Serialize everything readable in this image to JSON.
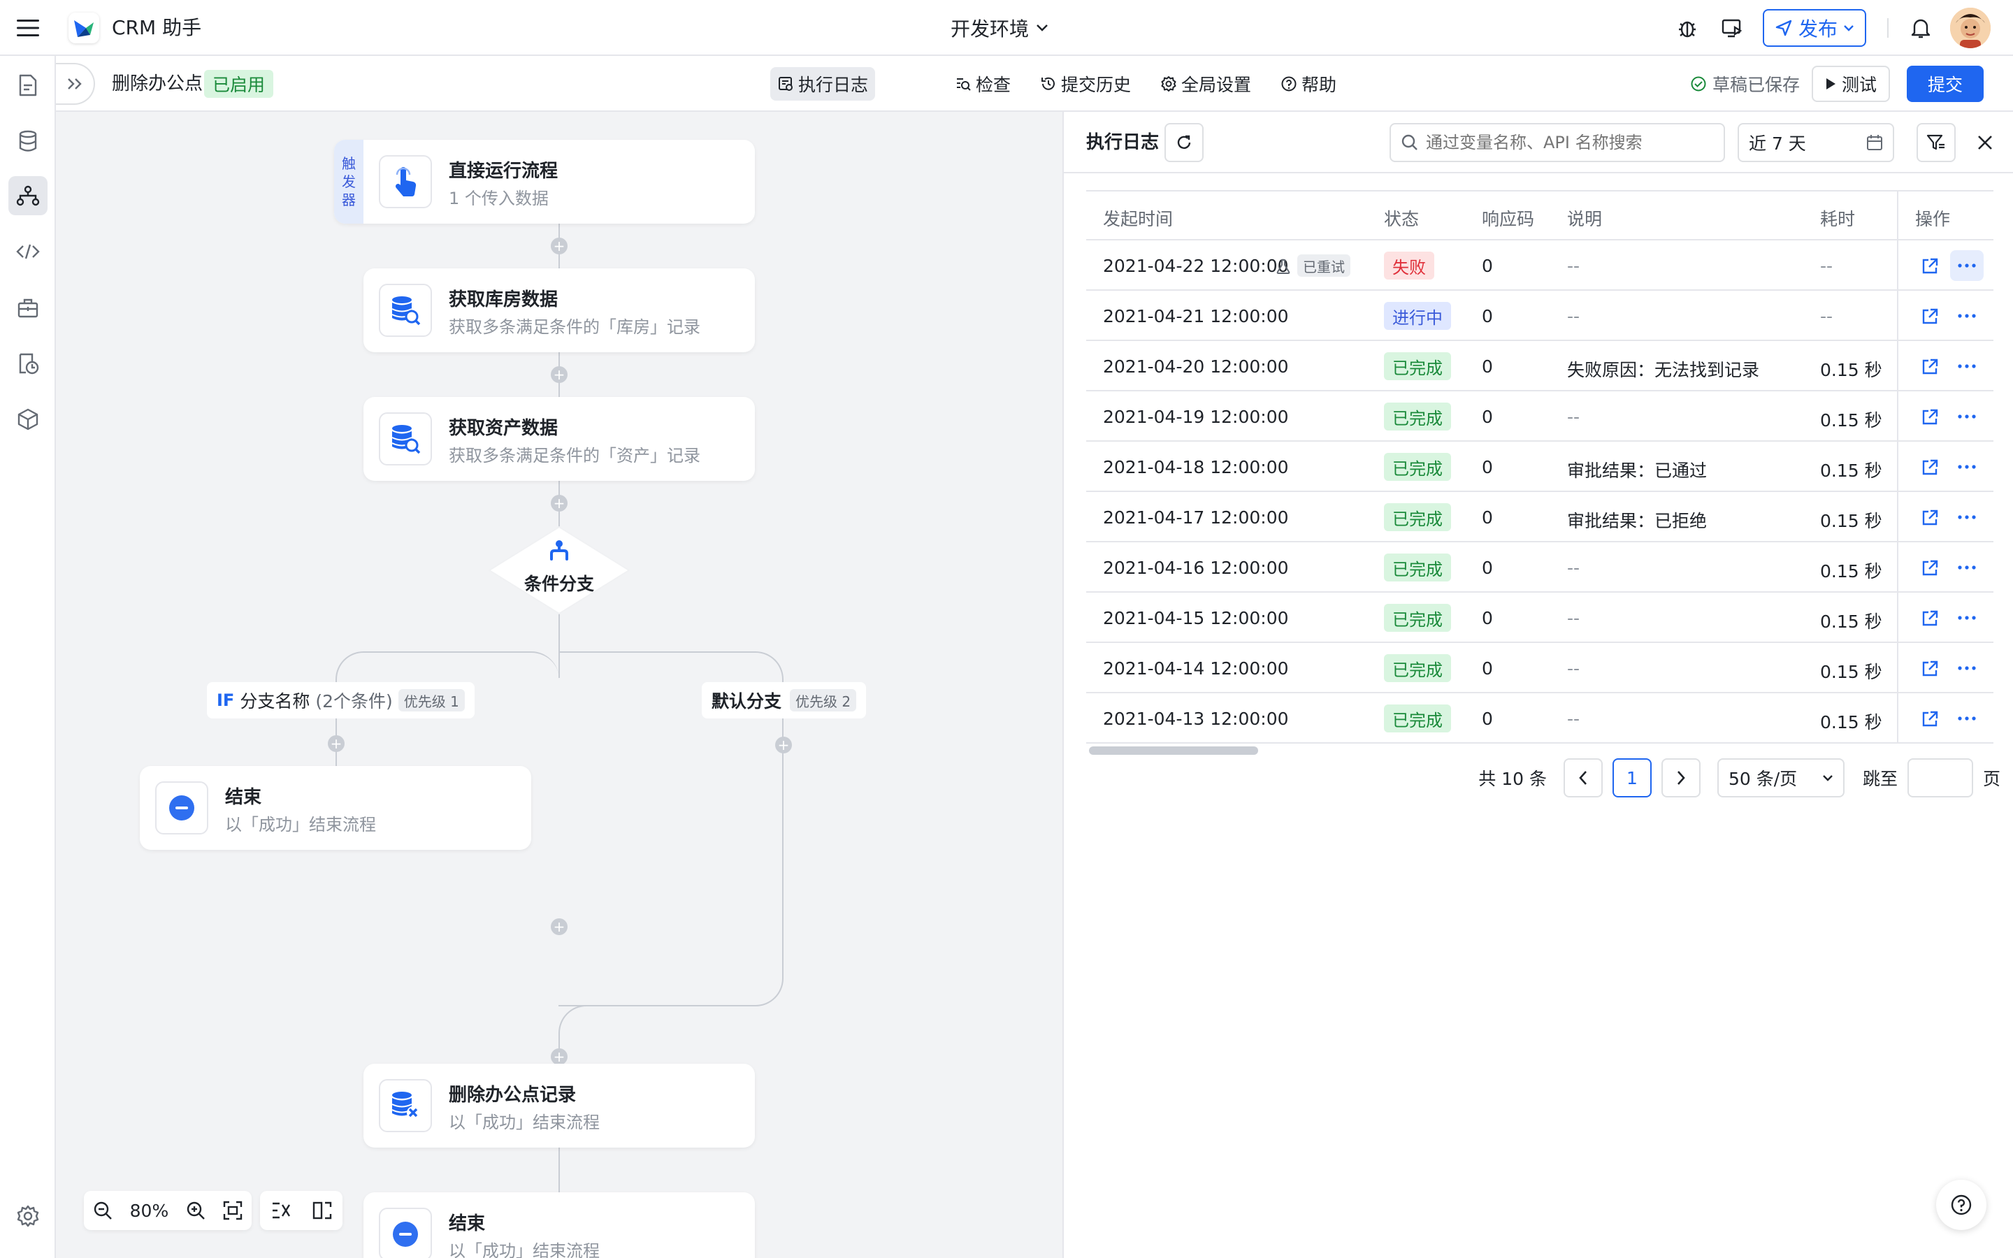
{
  "app": {
    "title": "CRM 助手",
    "environment": "开发环境"
  },
  "topbar": {
    "publish_label": "发布"
  },
  "subbar": {
    "flow_name": "删除办公点",
    "flow_status": "已启用",
    "tabs": [
      "执行日志",
      "检查",
      "提交历史",
      "全局设置",
      "帮助"
    ],
    "draft_status": "草稿已保存",
    "test_label": "测试",
    "submit_label": "提交"
  },
  "flow": {
    "trigger_badge": "触发器",
    "nodes": {
      "trigger": {
        "title": "直接运行流程",
        "subtitle": "1 个传入数据"
      },
      "get_warehouse": {
        "title": "获取库房数据",
        "subtitle": "获取多条满足条件的「库房」记录"
      },
      "get_assets": {
        "title": "获取资产数据",
        "subtitle": "获取多条满足条件的「资产」记录"
      },
      "branch": {
        "title": "条件分支"
      },
      "end_if": {
        "title": "结束",
        "subtitle": "以「成功」结束流程"
      },
      "delete_record": {
        "title": "删除办公点记录",
        "subtitle": "以「成功」结束流程"
      },
      "end_final": {
        "title": "结束",
        "subtitle": "以「成功」结束流程"
      }
    },
    "branches": {
      "if": {
        "keyword": "IF",
        "name": "分支名称",
        "conditions": "(2个条件)",
        "priority": "优先级 1"
      },
      "default": {
        "name": "默认分支",
        "priority": "优先级 2"
      }
    },
    "zoom": "80%"
  },
  "log_panel": {
    "title": "执行日志",
    "search_placeholder": "通过变量名称、API 名称搜索",
    "date_range": "近 7 天",
    "columns": {
      "time": "发起时间",
      "status": "状态",
      "code": "响应码",
      "desc": "说明",
      "duration": "耗时",
      "actions": "操作"
    },
    "retried_tag": "已重试",
    "rows": [
      {
        "time": "2021-04-22 12:00:00",
        "status": "失败",
        "status_type": "red",
        "code": "0",
        "desc": "--",
        "duration": "--",
        "retried": true
      },
      {
        "time": "2021-04-21 12:00:00",
        "status": "进行中",
        "status_type": "blue",
        "code": "0",
        "desc": "--",
        "duration": "--",
        "retried": false
      },
      {
        "time": "2021-04-20 12:00:00",
        "status": "已完成",
        "status_type": "green",
        "code": "0",
        "desc": "失败原因：无法找到记录",
        "duration": "0.15 秒",
        "retried": false
      },
      {
        "time": "2021-04-19 12:00:00",
        "status": "已完成",
        "status_type": "green",
        "code": "0",
        "desc": "--",
        "duration": "0.15 秒",
        "retried": false
      },
      {
        "time": "2021-04-18 12:00:00",
        "status": "已完成",
        "status_type": "green",
        "code": "0",
        "desc": "审批结果：已通过",
        "duration": "0.15 秒",
        "retried": false
      },
      {
        "time": "2021-04-17 12:00:00",
        "status": "已完成",
        "status_type": "green",
        "code": "0",
        "desc": "审批结果：已拒绝",
        "duration": "0.15 秒",
        "retried": false
      },
      {
        "time": "2021-04-16 12:00:00",
        "status": "已完成",
        "status_type": "green",
        "code": "0",
        "desc": "--",
        "duration": "0.15 秒",
        "retried": false
      },
      {
        "time": "2021-04-15 12:00:00",
        "status": "已完成",
        "status_type": "green",
        "code": "0",
        "desc": "--",
        "duration": "0.15 秒",
        "retried": false
      },
      {
        "time": "2021-04-14 12:00:00",
        "status": "已完成",
        "status_type": "green",
        "code": "0",
        "desc": "--",
        "duration": "0.15 秒",
        "retried": false
      },
      {
        "time": "2021-04-13 12:00:00",
        "status": "已完成",
        "status_type": "green",
        "code": "0",
        "desc": "--",
        "duration": "0.15 秒",
        "retried": false
      }
    ],
    "pagination": {
      "total": "共 10 条",
      "current_page": "1",
      "page_size": "50 条/页",
      "jump_label": "跳至",
      "page_suffix": "页"
    }
  },
  "colors": {
    "accent": "#1f66f0",
    "success": "#1a8a3a",
    "danger": "#e0303a",
    "canvas_bg": "#f2f3f5"
  }
}
